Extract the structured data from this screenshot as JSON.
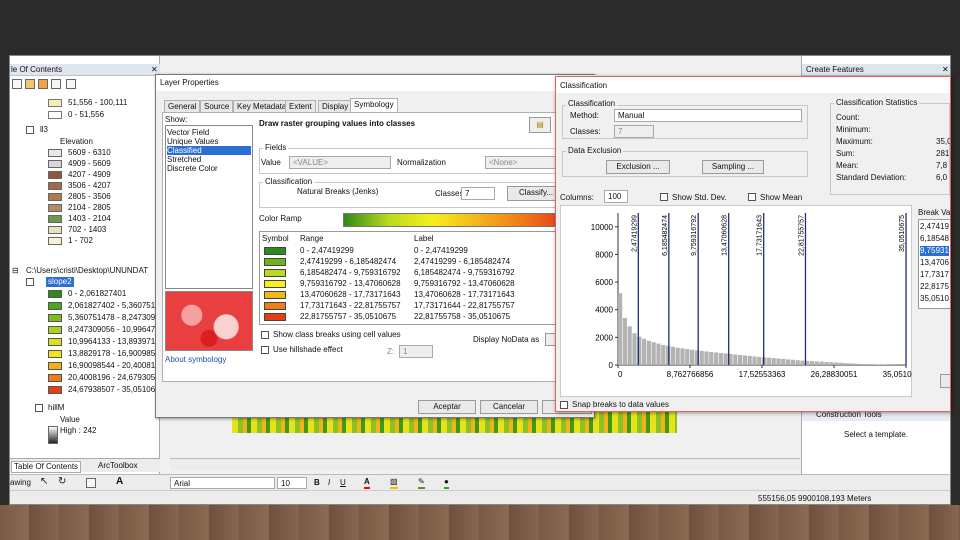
{
  "toc": {
    "title": "le Of Contents",
    "top_rows": [
      "51,556 - 100,111",
      "0 - 51,556"
    ],
    "layer_name": "ll3",
    "elevation_label": "Elevation",
    "elevation_rows": [
      "5609 - 6310",
      "4909 - 5609",
      "4207 - 4909",
      "3506 - 4207",
      "2805 - 3506",
      "2104 - 2805",
      "1403 - 2104",
      "702 - 1403",
      "1 - 702"
    ],
    "path": "C:\\Users\\cristi\\Desktop\\UNUNDAT",
    "slope_layer": "slope2",
    "slope_rows": [
      "0 - 2,061827401",
      "2,061827402 - 5,360751477",
      "5,360751478 - 8,247309955",
      "8,247309056 - 10,99647829",
      "10,9964133 - 13,89397177",
      "13,8829178 - 16,90098543",
      "16,90098544 - 20,40081976",
      "20,4008196 - 24,67930506",
      "24,67938507 - 35,0510675"
    ],
    "slope_colors": [
      "#2e8b18",
      "#4ea51c",
      "#7cbd1e",
      "#a8d21f",
      "#d6e41f",
      "#f3e21c",
      "#f2b01a",
      "#ee7a18",
      "#e43f16"
    ],
    "hill_layer": "hillM",
    "value_label": "Value",
    "high_label": "High : 242",
    "bottom_tabs": [
      "Table Of Contents",
      "ArcToolbox"
    ]
  },
  "layer_props": {
    "title": "Layer Properties",
    "tabs": [
      "General",
      "Source",
      "Key Metadata",
      "Extent",
      "Display",
      "Symbology"
    ],
    "show_label": "Show:",
    "show_items": [
      "Vector Field",
      "Unique Values",
      "Classified",
      "Stretched",
      "Discrete Color"
    ],
    "selected_show": 2,
    "heading": "Draw raster grouping values into classes",
    "fields_label": "Fields",
    "value_label": "Value",
    "value_field": "<VALUE>",
    "normalization_label": "Normalization",
    "normalization_field": "<None>",
    "classification_label": "Classification",
    "method_text": "Natural Breaks (Jenks)",
    "classes_label": "Classes",
    "classes_value": "7",
    "classify_btn": "Classify...",
    "color_ramp_label": "Color Ramp",
    "col_symbol": "Symbol",
    "col_range": "Range",
    "col_label": "Label",
    "rows": [
      {
        "range": "0 - 2,47419299",
        "label": "0 - 2,47419299",
        "color": "#2e8b18"
      },
      {
        "range": "2,47419299 - 6,185482474",
        "label": "2,47419299 - 6,185482474",
        "color": "#6db21d"
      },
      {
        "range": "6,185482474 - 9,759316792",
        "label": "6,185482474 - 9,759316792",
        "color": "#b9d91f"
      },
      {
        "range": "9,759316792 - 13,47060628",
        "label": "9,759316792 - 13,47060628",
        "color": "#f7ef1c"
      },
      {
        "range": "13,47060628 - 17,73171643",
        "label": "13,47060628 - 17,73171643",
        "color": "#f4b71a"
      },
      {
        "range": "17,73171643 - 22,81755757",
        "label": "17,73171644 - 22,81755757",
        "color": "#ef7d18"
      },
      {
        "range": "22,81755757 - 35,0510675",
        "label": "22,81755758 - 35,0510675",
        "color": "#e43f16"
      }
    ],
    "show_breaks_label": "Show class breaks using cell values",
    "hillshade_label": "Use hillshade effect",
    "z_label": "Z:",
    "z_value": "1",
    "display_nodata": "Display NoData as",
    "about_link": "About symbology",
    "ok_btn": "Aceptar",
    "cancel_btn": "Cancelar",
    "apply_btn": "Ap"
  },
  "classification": {
    "title": "Classification",
    "group_label": "Classification",
    "method_label": "Method:",
    "method_value": "Manual",
    "classes_label": "Classes:",
    "classes_value": "7",
    "data_exclusion_label": "Data Exclusion",
    "exclusion_btn": "Exclusion ...",
    "sampling_btn": "Sampling ...",
    "stats_label": "Classification Statistics",
    "stat_names": [
      "Count:",
      "Minimum:",
      "Maximum:",
      "Sum:",
      "Mean:",
      "Standard Deviation:"
    ],
    "stat_values": [
      "",
      "",
      "35,0",
      "281,",
      "7,8",
      "6,0"
    ],
    "columns_label": "Columns:",
    "columns_value": "100",
    "show_std_dev": "Show Std. Dev.",
    "show_mean": "Show Mean",
    "break_values_label": "Break Val",
    "break_values": [
      "2,47419",
      "6,18548",
      "9,75931",
      "13,4706",
      "17,7317",
      "22,8175",
      "35,0510"
    ],
    "selected_break": 2,
    "snap_label": "Snap breaks to data values"
  },
  "chart_data": {
    "type": "bar",
    "y_ticks": [
      "10000",
      "8000",
      "6000",
      "4000",
      "2000",
      "0"
    ],
    "x_ticks": [
      "0",
      "8,762766856",
      "17,52553363",
      "26,28830051",
      "35,05106739"
    ],
    "xlim": [
      0,
      35.0510675
    ],
    "ylim": [
      0,
      11000
    ],
    "breaks": [
      2.47419299,
      6.185482474,
      9.759316792,
      13.47060628,
      17.73171643,
      22.81755757,
      35.0510675
    ],
    "break_labels": [
      "2,47419299",
      "6,185482474",
      "9,759316792",
      "13,47060628",
      "17,73171643",
      "22,81755757",
      "35,0510675"
    ],
    "histogram": [
      5200,
      3400,
      2800,
      2300,
      2050,
      1900,
      1750,
      1650,
      1550,
      1450,
      1380,
      1320,
      1250,
      1200,
      1150,
      1100,
      1060,
      1020,
      980,
      940,
      900,
      860,
      830,
      800,
      760,
      720,
      690,
      660,
      620,
      590,
      560,
      530,
      500,
      470,
      440,
      410,
      380,
      350,
      320,
      300,
      280,
      260,
      240,
      220,
      200,
      180,
      160,
      140,
      120,
      100,
      85,
      70,
      60,
      50,
      40,
      30,
      25,
      20,
      15,
      10
    ]
  },
  "create_features": {
    "title": "Create Features",
    "template_hint": "Select a template.",
    "construction_tools": "Construction Tools"
  },
  "status": {
    "coords": "555156,05  9900108,193 Meters",
    "font_name": "Arial",
    "font_size": "10"
  }
}
